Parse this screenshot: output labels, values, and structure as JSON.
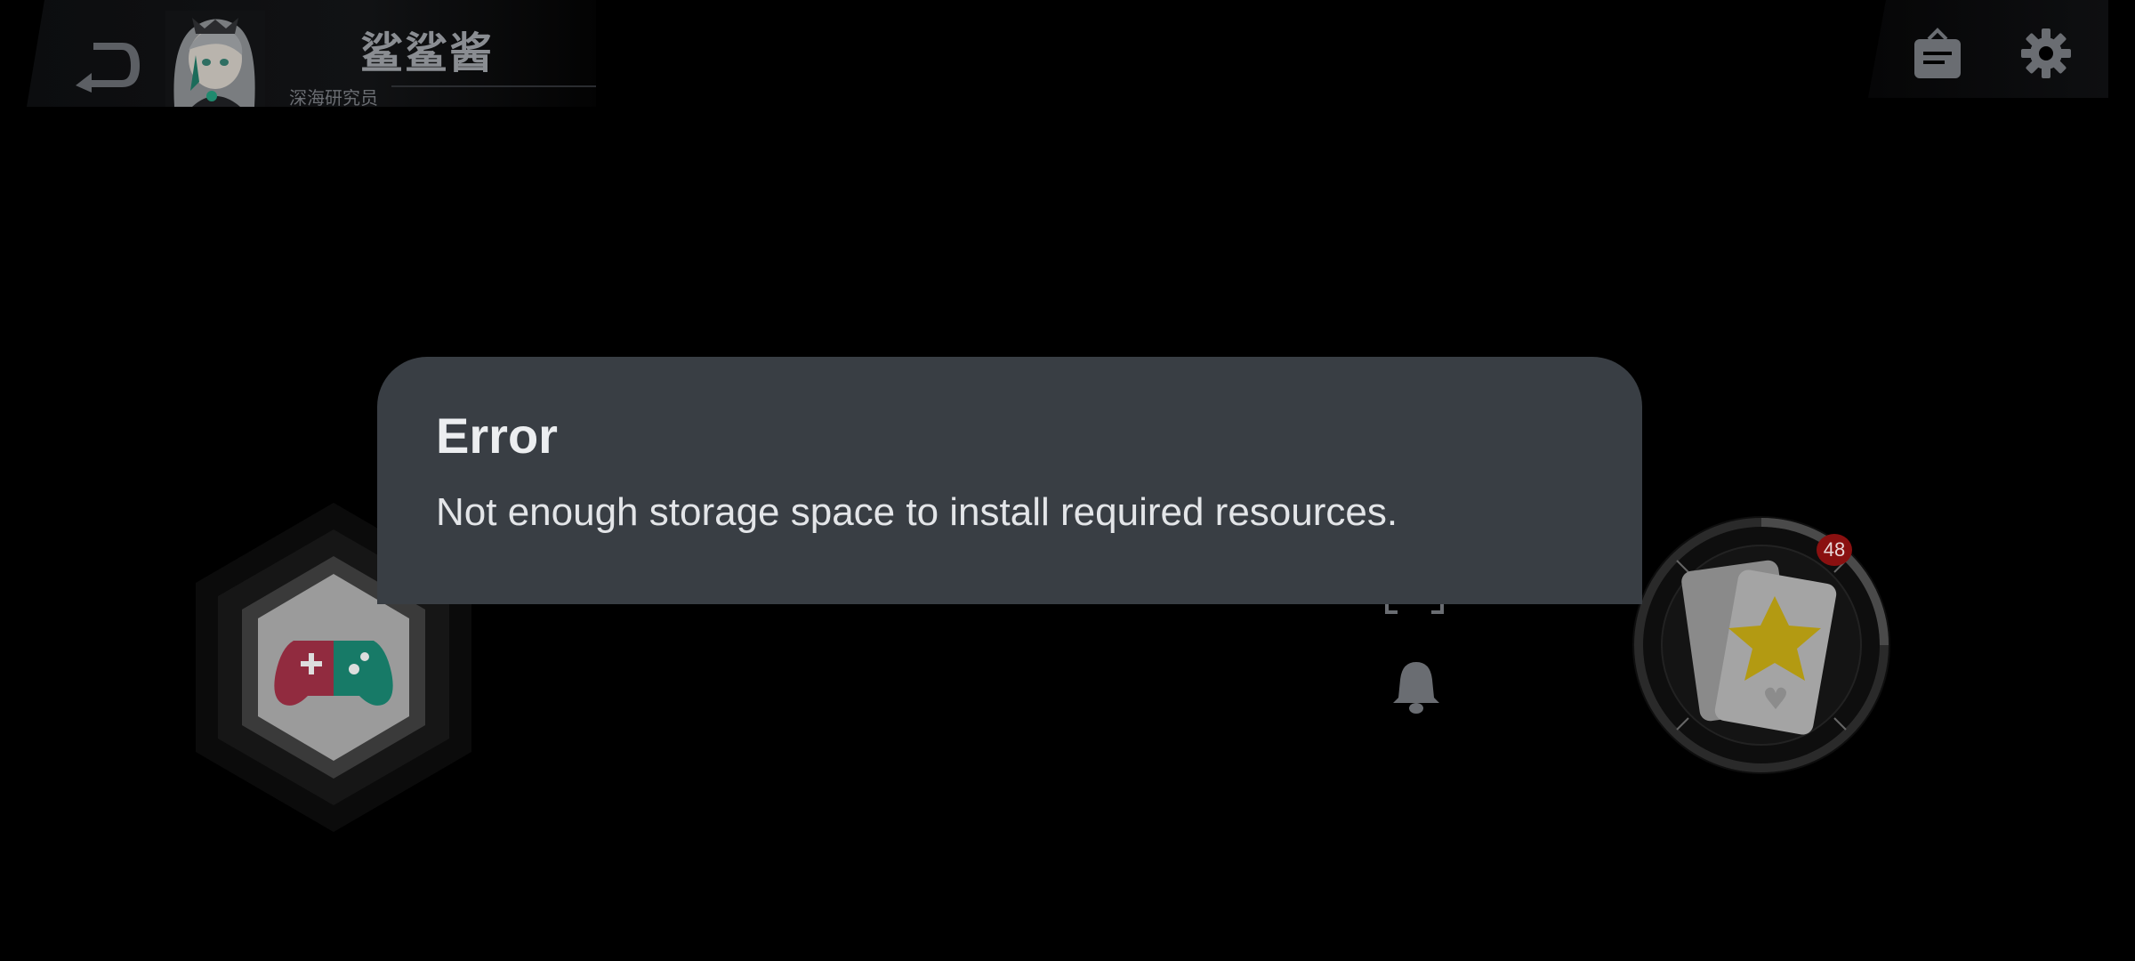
{
  "header": {
    "username": "鲨鲨酱",
    "user_title": "深海研究员"
  },
  "gacha": {
    "badge_count": "48"
  },
  "dialog": {
    "title": "Error",
    "message": "Not enough storage space to install required resources."
  },
  "colors": {
    "dialog_bg": "#393e44",
    "badge_red": "#8a1010",
    "gamepad_left": "#c23a55",
    "gamepad_right": "#1fa38a"
  }
}
